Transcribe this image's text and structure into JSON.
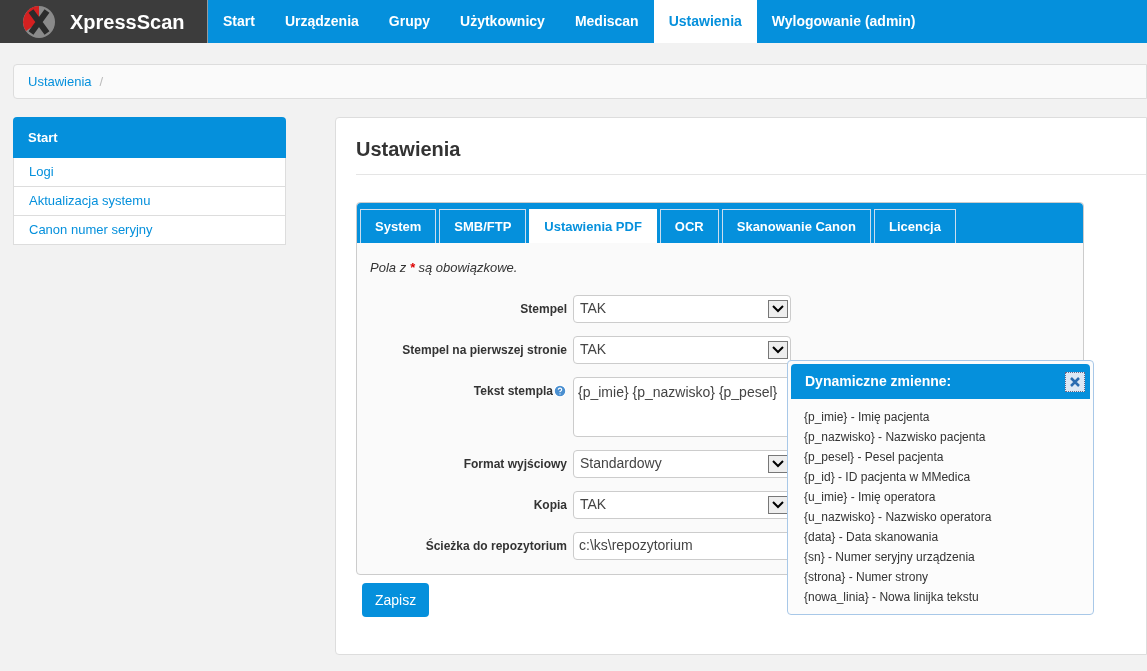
{
  "brand": {
    "name": "XpressScan"
  },
  "nav": [
    {
      "label": "Start",
      "selected": false
    },
    {
      "label": "Urządzenia",
      "selected": false
    },
    {
      "label": "Grupy",
      "selected": false
    },
    {
      "label": "Użytkownicy",
      "selected": false
    },
    {
      "label": "Mediscan",
      "selected": false
    },
    {
      "label": "Ustawienia",
      "selected": true
    },
    {
      "label": "Wylogowanie (admin)",
      "selected": false
    }
  ],
  "breadcrumb": [
    {
      "label": "Ustawienia",
      "separator": "/"
    }
  ],
  "sidebar": {
    "items": [
      {
        "label": "Start",
        "selected": true
      },
      {
        "label": "Logi",
        "selected": false
      },
      {
        "label": "Aktualizacja systemu",
        "selected": false
      },
      {
        "label": "Canon numer seryjny",
        "selected": false
      }
    ]
  },
  "page_title": "Ustawienia",
  "tabs": [
    {
      "label": "System",
      "selected": false
    },
    {
      "label": "SMB/FTP",
      "selected": false
    },
    {
      "label": "Ustawienia PDF",
      "selected": true
    },
    {
      "label": "OCR",
      "selected": false
    },
    {
      "label": "Skanowanie Canon",
      "selected": false
    },
    {
      "label": "Licencja",
      "selected": false
    }
  ],
  "required_note": {
    "prefix": "Pola z",
    "mark": "*",
    "suffix": "są obowiązkowe."
  },
  "fields": [
    {
      "kind": "select",
      "label": "Stempel",
      "value": "TAK",
      "help": false
    },
    {
      "kind": "select",
      "label": "Stempel na pierwszej stronie",
      "value": "TAK",
      "help": false
    },
    {
      "kind": "textarea",
      "label": "Tekst stempla",
      "value": "{p_imie} {p_nazwisko} {p_pesel}",
      "help": true
    },
    {
      "kind": "select",
      "label": "Format wyjściowy",
      "value": "Standardowy",
      "help": false
    },
    {
      "kind": "select",
      "label": "Kopia",
      "value": "TAK",
      "help": false
    },
    {
      "kind": "text",
      "label": "Ścieżka do repozytorium",
      "value": "c:\\ks\\repozytorium",
      "help": false
    }
  ],
  "save_button": "Zapisz",
  "popover": {
    "title": "Dynamiczne zmienne:",
    "items": [
      "{p_imie} - Imię pacjenta",
      "{p_nazwisko} - Nazwisko pacjenta",
      "{p_pesel} - Pesel pacjenta",
      "{p_id} - ID pacjenta w MMedica",
      "{u_imie} - Imię operatora",
      "{u_nazwisko} - Nazwisko operatora",
      "{data} - Data skanowania",
      "{sn} - Numer seryjny urządzenia",
      "{strona} - Numer strony",
      "{nowa_linia} - Nowa linijka tekstu"
    ]
  }
}
